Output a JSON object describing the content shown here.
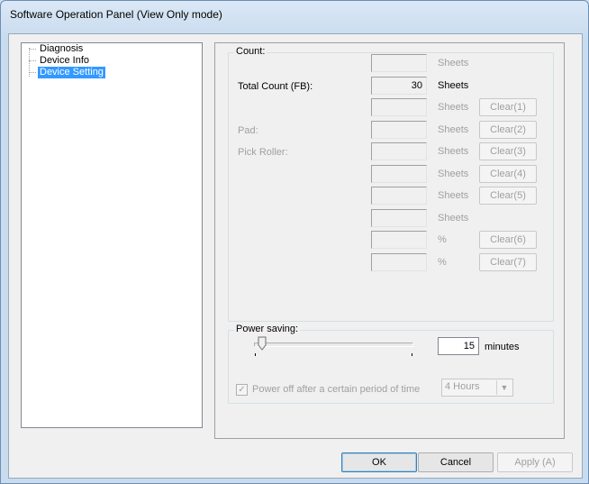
{
  "window": {
    "title": "Software Operation Panel (View Only mode)"
  },
  "tree": {
    "items": [
      {
        "label": "Diagnosis",
        "selected": false
      },
      {
        "label": "Device Info",
        "selected": false
      },
      {
        "label": "Device Setting",
        "selected": true
      }
    ]
  },
  "count_group": {
    "title": "Count:",
    "rows": [
      {
        "label": "",
        "value": "",
        "unit": "Sheets",
        "button": "",
        "enabled": false
      },
      {
        "label": "Total Count (FB):",
        "value": "30",
        "unit": "Sheets",
        "button": "",
        "enabled": true
      },
      {
        "label": "",
        "value": "",
        "unit": "Sheets",
        "button": "Clear(1)",
        "enabled": false
      },
      {
        "label": "Pad:",
        "value": "",
        "unit": "Sheets",
        "button": "Clear(2)",
        "enabled": false
      },
      {
        "label": "Pick Roller:",
        "value": "",
        "unit": "Sheets",
        "button": "Clear(3)",
        "enabled": false
      },
      {
        "label": "",
        "value": "",
        "unit": "Sheets",
        "button": "Clear(4)",
        "enabled": false
      },
      {
        "label": "",
        "value": "",
        "unit": "Sheets",
        "button": "Clear(5)",
        "enabled": false
      },
      {
        "label": "",
        "value": "",
        "unit": "Sheets",
        "button": "",
        "enabled": false
      },
      {
        "label": "",
        "value": "",
        "unit": "%",
        "button": "Clear(6)",
        "enabled": false
      },
      {
        "label": "",
        "value": "",
        "unit": "%",
        "button": "Clear(7)",
        "enabled": false
      }
    ]
  },
  "power_group": {
    "title": "Power saving:",
    "slider_value_fraction": 0.05,
    "minutes_value": "15",
    "minutes_label": "minutes",
    "power_off_label": "Power off after a certain period of time",
    "power_off_checked": true,
    "power_off_select": "4 Hours"
  },
  "buttons": {
    "ok": "OK",
    "cancel": "Cancel",
    "apply": "Apply (A)"
  },
  "colors": {
    "selection": "#3399ff",
    "disabled_text": "#a0a0a0"
  }
}
